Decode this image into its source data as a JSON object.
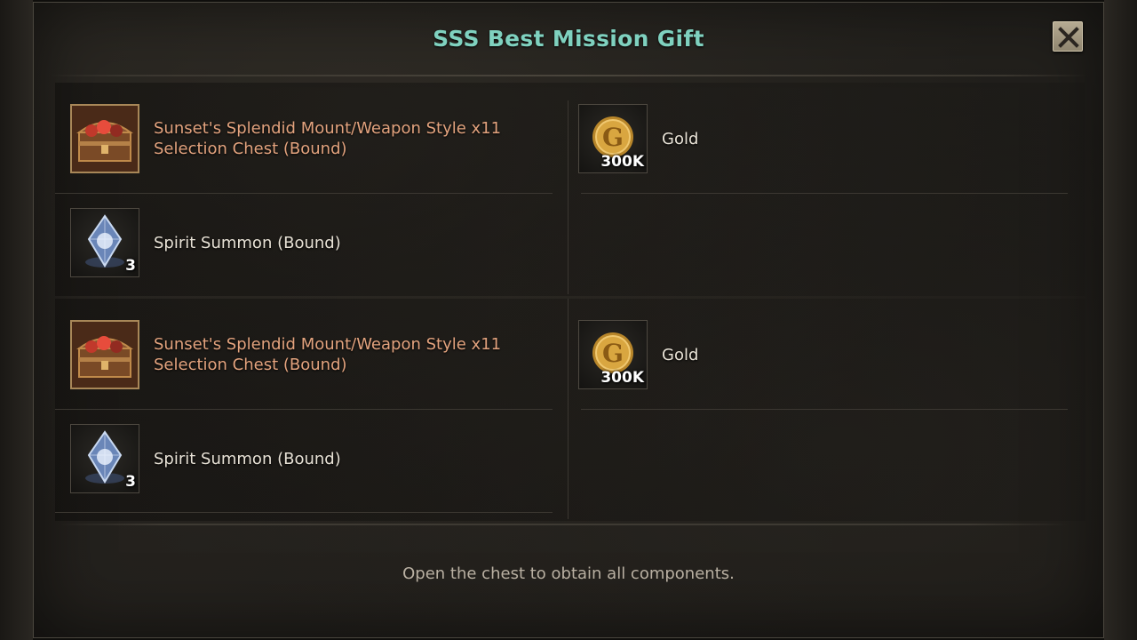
{
  "dialog": {
    "title": "SSS Best Mission Gift",
    "close_icon": "close-x-icon",
    "footer_text": "Open the chest to obtain all components."
  },
  "groups": [
    {
      "items": [
        {
          "name": "Sunset's Splendid Mount/Weapon Style x11 Selection Chest (Bound)",
          "icon": "treasure-chest-icon",
          "count": "",
          "rarity_color": "#e3a37e"
        },
        {
          "name": "Gold",
          "icon": "gold-coin-icon",
          "count": "300K",
          "rarity_color": "#e8e2d6"
        },
        {
          "name": "Spirit Summon (Bound)",
          "icon": "spirit-crystal-icon",
          "count": "3",
          "rarity_color": "#e8e2d6"
        }
      ]
    },
    {
      "items": [
        {
          "name": "Sunset's Splendid Mount/Weapon Style x11 Selection Chest (Bound)",
          "icon": "treasure-chest-icon",
          "count": "",
          "rarity_color": "#e3a37e"
        },
        {
          "name": "Gold",
          "icon": "gold-coin-icon",
          "count": "300K",
          "rarity_color": "#e8e2d6"
        },
        {
          "name": "Spirit Summon (Bound)",
          "icon": "spirit-crystal-icon",
          "count": "3",
          "rarity_color": "#e8e2d6"
        }
      ]
    }
  ],
  "colors": {
    "title": "#7fd1bf",
    "rare_item": "#e3a37e",
    "normal_item": "#e8e2d6",
    "footer": "#b9b0a2"
  }
}
